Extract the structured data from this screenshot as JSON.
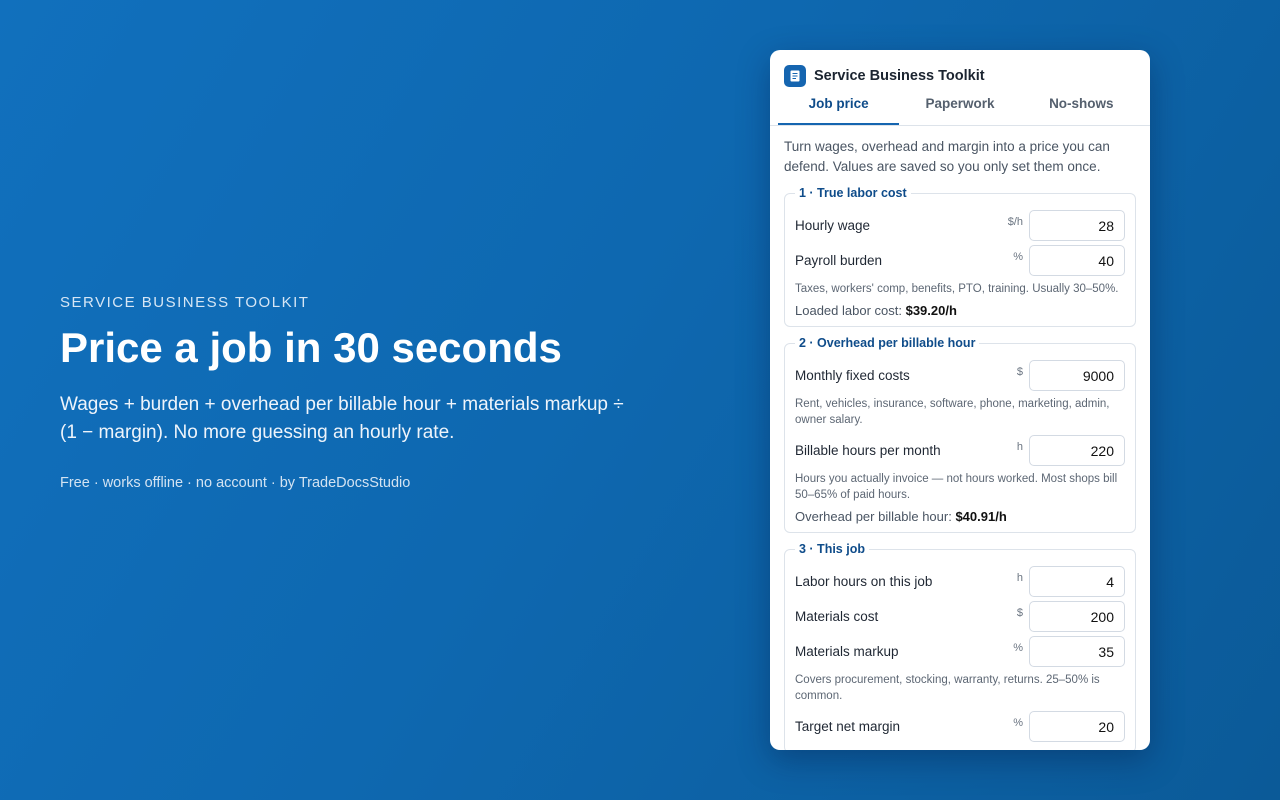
{
  "hero": {
    "eyebrow": "SERVICE BUSINESS TOOLKIT",
    "title": "Price a job in 30 seconds",
    "subtitle": "Wages + burden + overhead per billable hour + materials markup ÷ (1 − margin). No more guessing an hourly rate.",
    "meta": "Free · works offline · no account · by TradeDocsStudio"
  },
  "panel": {
    "title": "Service Business Toolkit",
    "icon": "document-icon",
    "tabs": [
      {
        "label": "Job price",
        "active": true
      },
      {
        "label": "Paperwork",
        "active": false
      },
      {
        "label": "No-shows",
        "active": false
      }
    ],
    "intro": "Turn wages, overhead and margin into a price you can defend. Values are saved so you only set them once."
  },
  "sections": {
    "labor": {
      "legend": "1 · True labor cost",
      "hourly_wage": {
        "label": "Hourly wage",
        "unit": "$/h",
        "value": "28"
      },
      "payroll_burden": {
        "label": "Payroll burden",
        "unit": "%",
        "value": "40"
      },
      "hint": "Taxes, workers' comp, benefits, PTO, training. Usually 30–50%.",
      "result_label": "Loaded labor cost:",
      "result_value": "$39.20/h"
    },
    "overhead": {
      "legend": "2 · Overhead per billable hour",
      "monthly_fixed": {
        "label": "Monthly fixed costs",
        "unit": "$",
        "value": "9000"
      },
      "monthly_fixed_hint": "Rent, vehicles, insurance, software, phone, marketing, admin, owner salary.",
      "billable_hours": {
        "label": "Billable hours per month",
        "unit": "h",
        "value": "220"
      },
      "billable_hours_hint": "Hours you actually invoice — not hours worked. Most shops bill 50–65% of paid hours.",
      "result_label": "Overhead per billable hour:",
      "result_value": "$40.91/h"
    },
    "job": {
      "legend": "3 · This job",
      "labor_hours": {
        "label": "Labor hours on this job",
        "unit": "h",
        "value": "4"
      },
      "materials_cost": {
        "label": "Materials cost",
        "unit": "$",
        "value": "200"
      },
      "materials_markup": {
        "label": "Materials markup",
        "unit": "%",
        "value": "35"
      },
      "markup_hint": "Covers procurement, stocking, warranty, returns. 25–50% is common.",
      "target_margin": {
        "label": "Target net margin",
        "unit": "%",
        "value": "20"
      }
    }
  }
}
